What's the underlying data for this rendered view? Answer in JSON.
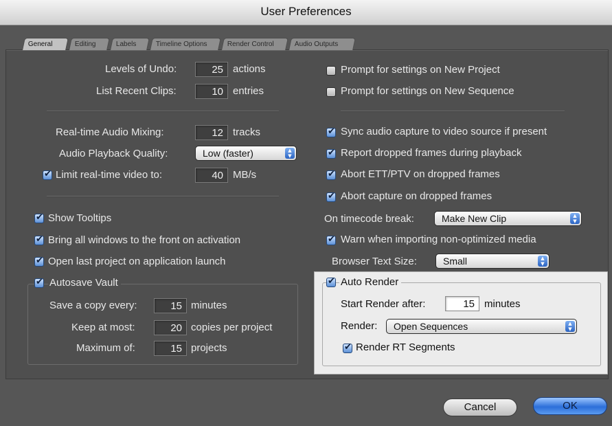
{
  "window": {
    "title": "User Preferences"
  },
  "tabs": [
    "General",
    "Editing",
    "Labels",
    "Timeline Options",
    "Render Control",
    "Audio Outputs"
  ],
  "left": {
    "levels_undo": {
      "label": "Levels of Undo:",
      "value": "25",
      "unit": "actions"
    },
    "recent_clips": {
      "label": "List Recent Clips:",
      "value": "10",
      "unit": "entries"
    },
    "audio_mixing": {
      "label": "Real-time Audio Mixing:",
      "value": "12",
      "unit": "tracks"
    },
    "playback_quality": {
      "label": "Audio Playback Quality:",
      "value": "Low (faster)"
    },
    "limit_video": {
      "label": "Limit real-time video to:",
      "value": "40",
      "unit": "MB/s",
      "checked": true
    },
    "show_tooltips": {
      "label": "Show Tooltips",
      "checked": true
    },
    "bring_windows": {
      "label": "Bring all windows to the front on activation",
      "checked": true
    },
    "open_last": {
      "label": "Open last project on application launch",
      "checked": true
    },
    "autosave": {
      "label": "Autosave Vault",
      "checked": true,
      "save_copy": {
        "label": "Save a copy every:",
        "value": "15",
        "unit": "minutes"
      },
      "keep_most": {
        "label": "Keep at most:",
        "value": "20",
        "unit": "copies per project"
      },
      "maximum": {
        "label": "Maximum of:",
        "value": "15",
        "unit": "projects"
      }
    }
  },
  "right": {
    "prompt_project": {
      "label": "Prompt for settings on New Project",
      "checked": false
    },
    "prompt_sequence": {
      "label": "Prompt for settings on New Sequence",
      "checked": false
    },
    "sync_audio": {
      "label": "Sync audio capture to video source if present",
      "checked": true
    },
    "report_dropped": {
      "label": "Report dropped frames during playback",
      "checked": true
    },
    "abort_ett": {
      "label": "Abort ETT/PTV on dropped frames",
      "checked": true
    },
    "abort_capture": {
      "label": "Abort capture on dropped frames",
      "checked": true
    },
    "timecode_break": {
      "label": "On timecode break:",
      "value": "Make New Clip"
    },
    "warn_import": {
      "label": "Warn when importing non-optimized media",
      "checked": true
    },
    "browser_text": {
      "label": "Browser Text Size:",
      "value": "Small"
    },
    "auto_render": {
      "label": "Auto Render",
      "checked": true,
      "start_after": {
        "label": "Start Render after:",
        "value": "15",
        "unit": "minutes"
      },
      "render": {
        "label": "Render:",
        "value": "Open Sequences"
      },
      "rt_segments": {
        "label": "Render RT Segments",
        "checked": true
      }
    }
  },
  "buttons": {
    "cancel": "Cancel",
    "ok": "OK"
  },
  "colors": {
    "highlight_panel": "#ececec",
    "ok_button": "#2c6fd9",
    "checkbox_on": "#5b8fd6"
  }
}
